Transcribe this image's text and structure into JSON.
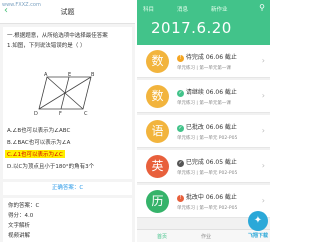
{
  "watermark": "www.FXXZ.com",
  "left": {
    "back_icon": "‹",
    "title": "试题",
    "question_intro": "一.根据题意，从所给选项中选择最佳答案",
    "question_text": "1.如图，下列说法错误的是（ ）",
    "figure_labels": [
      "A",
      "B",
      "C",
      "D",
      "E",
      "F"
    ],
    "options": [
      {
        "label": "A.∠B也可以表示为∠ABC",
        "selected": false
      },
      {
        "label": "B.∠BAC也可以表示为∠A",
        "selected": false
      },
      {
        "label": "C.∠1也可以表示为∠C",
        "selected": true
      },
      {
        "label": "D.以C为顶点且小于180°的角有3个",
        "selected": false
      }
    ],
    "correct_answer": "正确答案：C",
    "my_answer": "你的答案：C",
    "score": "得分：4.0",
    "text_explanation": "文字解析",
    "video_explanation": "视频讲解"
  },
  "right": {
    "tabs": [
      "科目",
      "消息",
      "新作业"
    ],
    "search_icon": "search-icon",
    "date": "2017.6.20",
    "homework": [
      {
        "subject": "数",
        "color": "#f2b43d",
        "status_icon": "!",
        "status_color": "#f5a623",
        "status": "待完成 06.06 截止",
        "meta": "单元练习 | 第一单元第一课"
      },
      {
        "subject": "数",
        "color": "#f2b43d",
        "status_icon": "✓",
        "status_color": "#42c38a",
        "status": "请继续 06.06 截止",
        "meta": "单元练习 | 第一单元第一课"
      },
      {
        "subject": "语",
        "color": "#f2b43d",
        "status_icon": "✓",
        "status_color": "#42c38a",
        "status": "已批改 06.06 截止",
        "meta": "单元练习 | 第一单元 P02-P05"
      },
      {
        "subject": "英",
        "color": "#e8603c",
        "status_icon": "✓",
        "status_color": "#555555",
        "status": "已完成 06.05 截止",
        "meta": "单元练习 | 第一单元 P02-P05"
      },
      {
        "subject": "历",
        "color": "#35b36a",
        "status_icon": "!",
        "status_color": "#e8603c",
        "status": "批改中 06.06 截止",
        "meta": "单元练习 | 第一单元 P02-P05"
      }
    ],
    "nav": [
      "首页",
      "作业"
    ],
    "logo_icon": "✦",
    "logo_text": "飞翔下载"
  },
  "colors": {
    "brand_green": "#42c38a",
    "highlight_yellow": "#ffee00",
    "answer_blue": "#2c9ae8"
  }
}
